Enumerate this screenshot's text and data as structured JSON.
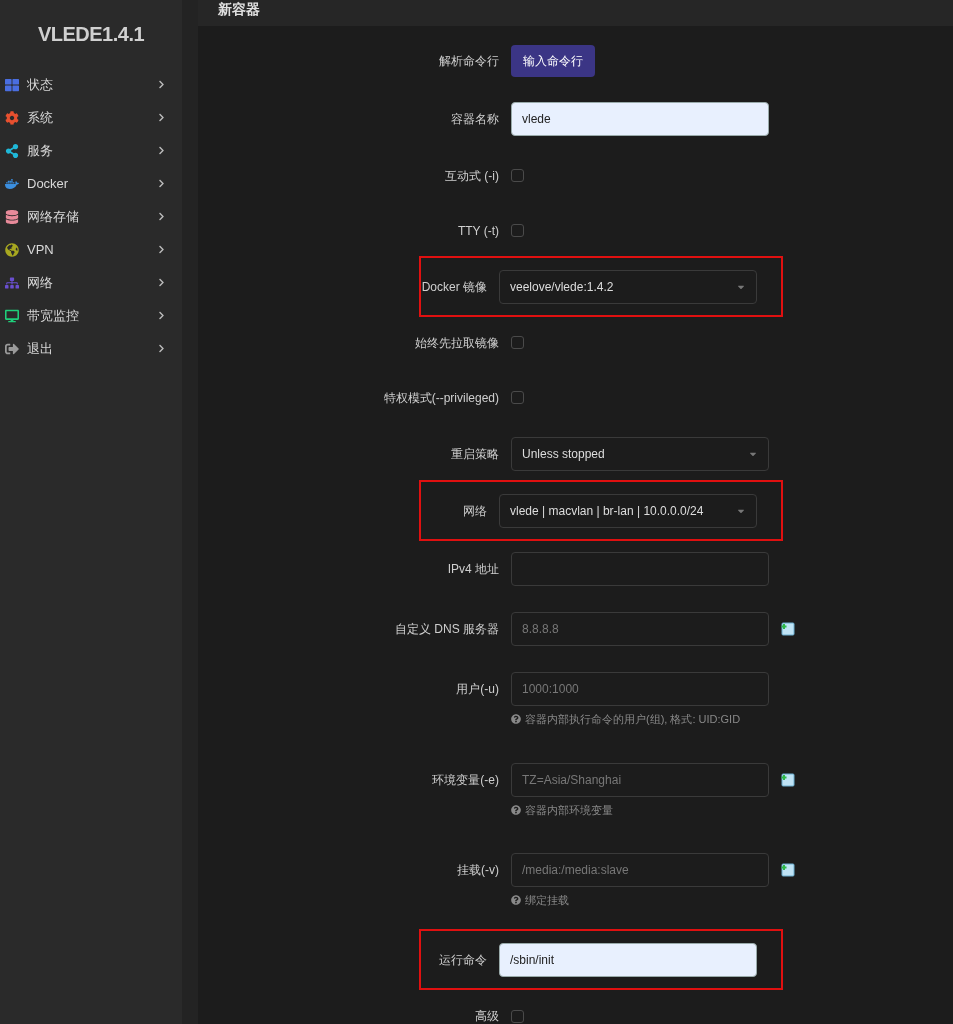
{
  "sidebar": {
    "logo": "VLEDE1.4.1",
    "items": [
      {
        "label": "状态",
        "color": "#4a6ee0",
        "expanded": false
      },
      {
        "label": "系统",
        "color": "#e8502f",
        "expanded": false
      },
      {
        "label": "服务",
        "color": "#1fb8d8",
        "expanded": false
      },
      {
        "label": "Docker",
        "color": "#3b8fe0",
        "expanded": false
      },
      {
        "label": "网络存储",
        "color": "#e88a9a",
        "expanded": false
      },
      {
        "label": "VPN",
        "color": "#a8a820",
        "expanded": false
      },
      {
        "label": "网络",
        "color": "#6a4fd0",
        "expanded": false
      },
      {
        "label": "带宽监控",
        "color": "#1fcf7a",
        "expanded": false
      },
      {
        "label": "退出",
        "color": "#9a9a9a",
        "expanded": false
      }
    ]
  },
  "page": {
    "title": "新容器"
  },
  "form": [
    {
      "kind": "button",
      "label": "解析命令行",
      "text": "输入命令行",
      "highlighted": false
    },
    {
      "kind": "text",
      "label": "容器名称",
      "value": "vlede",
      "highlighted": false
    },
    {
      "kind": "checkbox",
      "label": "互动式 (-i)",
      "checked": false,
      "highlighted": false
    },
    {
      "kind": "checkbox",
      "label": "TTY (-t)",
      "checked": false,
      "highlighted": false
    },
    {
      "kind": "select",
      "label": "Docker 镜像",
      "value": "veelove/vlede:1.4.2",
      "highlighted": true
    },
    {
      "kind": "checkbox",
      "label": "始终先拉取镜像",
      "checked": false,
      "highlighted": false
    },
    {
      "kind": "checkbox",
      "label": "特权模式(--privileged)",
      "checked": false,
      "highlighted": false
    },
    {
      "kind": "select",
      "label": "重启策略",
      "value": "Unless stopped",
      "highlighted": false
    },
    {
      "kind": "select",
      "label": "网络",
      "value": "vlede | macvlan | br-lan | 10.0.0.0/24",
      "highlighted": true
    },
    {
      "kind": "input",
      "label": "IPv4 地址",
      "highlighted": false
    },
    {
      "kind": "input",
      "label": "自定义 DNS 服务器",
      "placeholder": "8.8.8.8",
      "add": true,
      "highlighted": false
    },
    {
      "kind": "input",
      "label": "用户(-u)",
      "placeholder": "1000:1000",
      "help": "容器内部执行命令的用户(组), 格式: UID:GID",
      "highlighted": false
    },
    {
      "kind": "input",
      "label": "环境变量(-e)",
      "placeholder": "TZ=Asia/Shanghai",
      "add": true,
      "help": "容器内部环境变量",
      "highlighted": false
    },
    {
      "kind": "input",
      "label": "挂载(-v)",
      "placeholder": "/media:/media:slave",
      "add": true,
      "help": "绑定挂载",
      "highlighted": false
    },
    {
      "kind": "text",
      "label": "运行命令",
      "value": "/sbin/init",
      "highlighted": true
    },
    {
      "kind": "checkbox",
      "label": "高级",
      "checked": false,
      "highlighted": false
    }
  ]
}
